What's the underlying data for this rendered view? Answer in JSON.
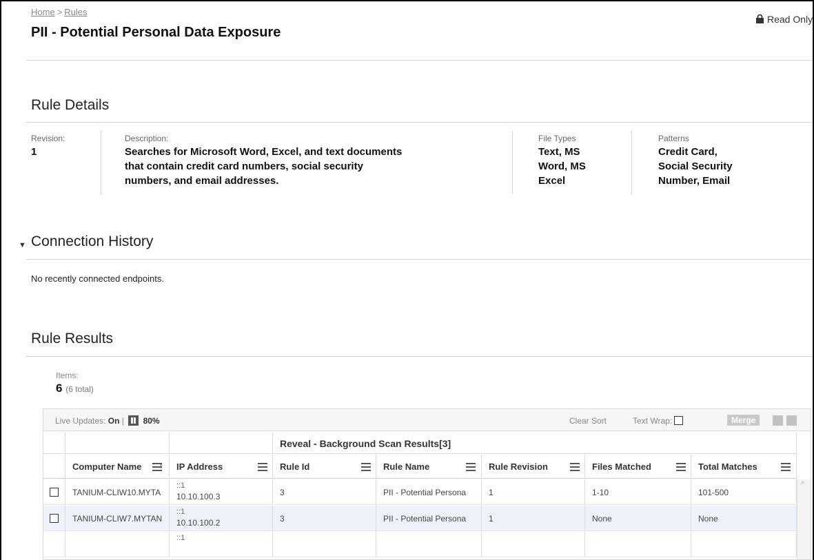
{
  "breadcrumb": {
    "home": "Home",
    "separator": ">",
    "rules": "Rules"
  },
  "page_title": "PII - Potential Personal Data Exposure",
  "read_only": "Read Only",
  "rule_details": {
    "title": "Rule Details",
    "revision_label": "Revision:",
    "revision_value": "1",
    "description_label": "Description:",
    "description_lines": [
      "Searches for Microsoft Word, Excel, and text documents",
      "that contain credit card numbers, social security",
      "numbers, and email addresses."
    ],
    "file_types_label": "File Types",
    "file_types_lines": [
      "Text, MS",
      "Word, MS",
      "Excel"
    ],
    "patterns_label": "Patterns",
    "patterns_lines": [
      "Credit Card,",
      "Social Security",
      "Number, Email"
    ]
  },
  "connection_history": {
    "title": "Connection History",
    "empty_message": "No recently connected endpoints."
  },
  "rule_results": {
    "title": "Rule Results",
    "items_label": "Items:",
    "items_count": "6",
    "items_total": "(6 total)"
  },
  "grid": {
    "live_updates_label": "Live Updates:",
    "live_updates_value": "On",
    "separator": "|",
    "live_percent": "80%",
    "clear_sort": "Clear Sort",
    "text_wrap": "Text Wrap:",
    "merge": "Merge",
    "group_header": "Reveal - Background Scan Results[3]",
    "columns": [
      "Computer Name",
      "IP Address",
      "Rule Id",
      "Rule Name",
      "Rule Revision",
      "Files Matched",
      "Total Matches"
    ],
    "sort_indicator": "↑",
    "rows": [
      {
        "computer": "TANIUM-CLIW10.MYTA",
        "ip_top": "::1",
        "ip_bottom": "10.10.100.3",
        "rule_id": "3",
        "rule_name": "PII - Potential Persona",
        "rule_revision": "1",
        "files_matched": "1-10",
        "total_matches": "101-500"
      },
      {
        "computer": "TANIUM-CLIW7.MYTAN",
        "ip_top": "::1",
        "ip_bottom": "10.10.100.2",
        "rule_id": "3",
        "rule_name": "PII - Potential Persona",
        "rule_revision": "1",
        "files_matched": "None",
        "total_matches": "None"
      },
      {
        "ip_top": "::1"
      }
    ]
  },
  "colors": {
    "row_alt": "#eef3fb",
    "divider": "#d4d4d4",
    "merge_disabled": "#c9c9c9"
  }
}
